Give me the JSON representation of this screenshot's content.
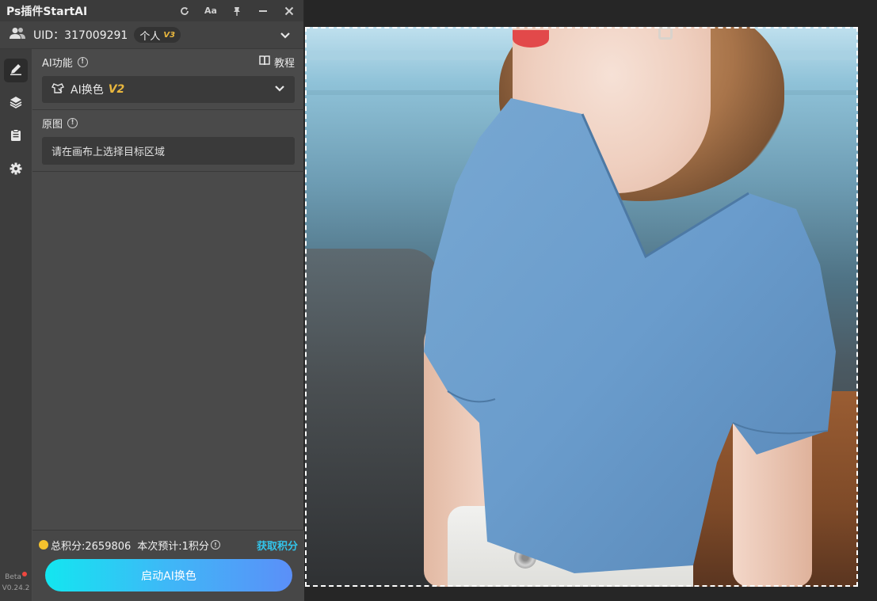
{
  "window": {
    "title": "Ps插件StartAI",
    "buttons": [
      "refresh-icon",
      "font-size-icon",
      "pin-icon",
      "minimize-icon",
      "close-icon"
    ],
    "font_button_label": "Aa"
  },
  "user": {
    "uid": "UID：317009291",
    "plan": "个人",
    "plan_version": "V3"
  },
  "sidebar": {
    "items": [
      "brush-icon",
      "layers-icon",
      "clipboard-icon",
      "gear-icon"
    ],
    "active": 0,
    "beta_label": "Beta",
    "version": "V0.24.2"
  },
  "main": {
    "function_label": "AI功能",
    "tutorial_label": "教程",
    "function_select": {
      "value": "AI换色",
      "version": "V2"
    },
    "source_label": "原图",
    "source_hint": "请在画布上选择目标区域"
  },
  "footer": {
    "total_points": "总积分:2659806",
    "estimate": "本次预计:1积分",
    "get_points": "获取积分",
    "start_button": "启动AI换色"
  },
  "colors": {
    "panel_bg": "#4a4a4a",
    "accent_gold": "#e9b73e",
    "link_cyan": "#33c4ea",
    "button_gradient_start": "#13e6f0",
    "button_gradient_end": "#5b8ff8",
    "shirt_blue": "#6a9ccc"
  }
}
